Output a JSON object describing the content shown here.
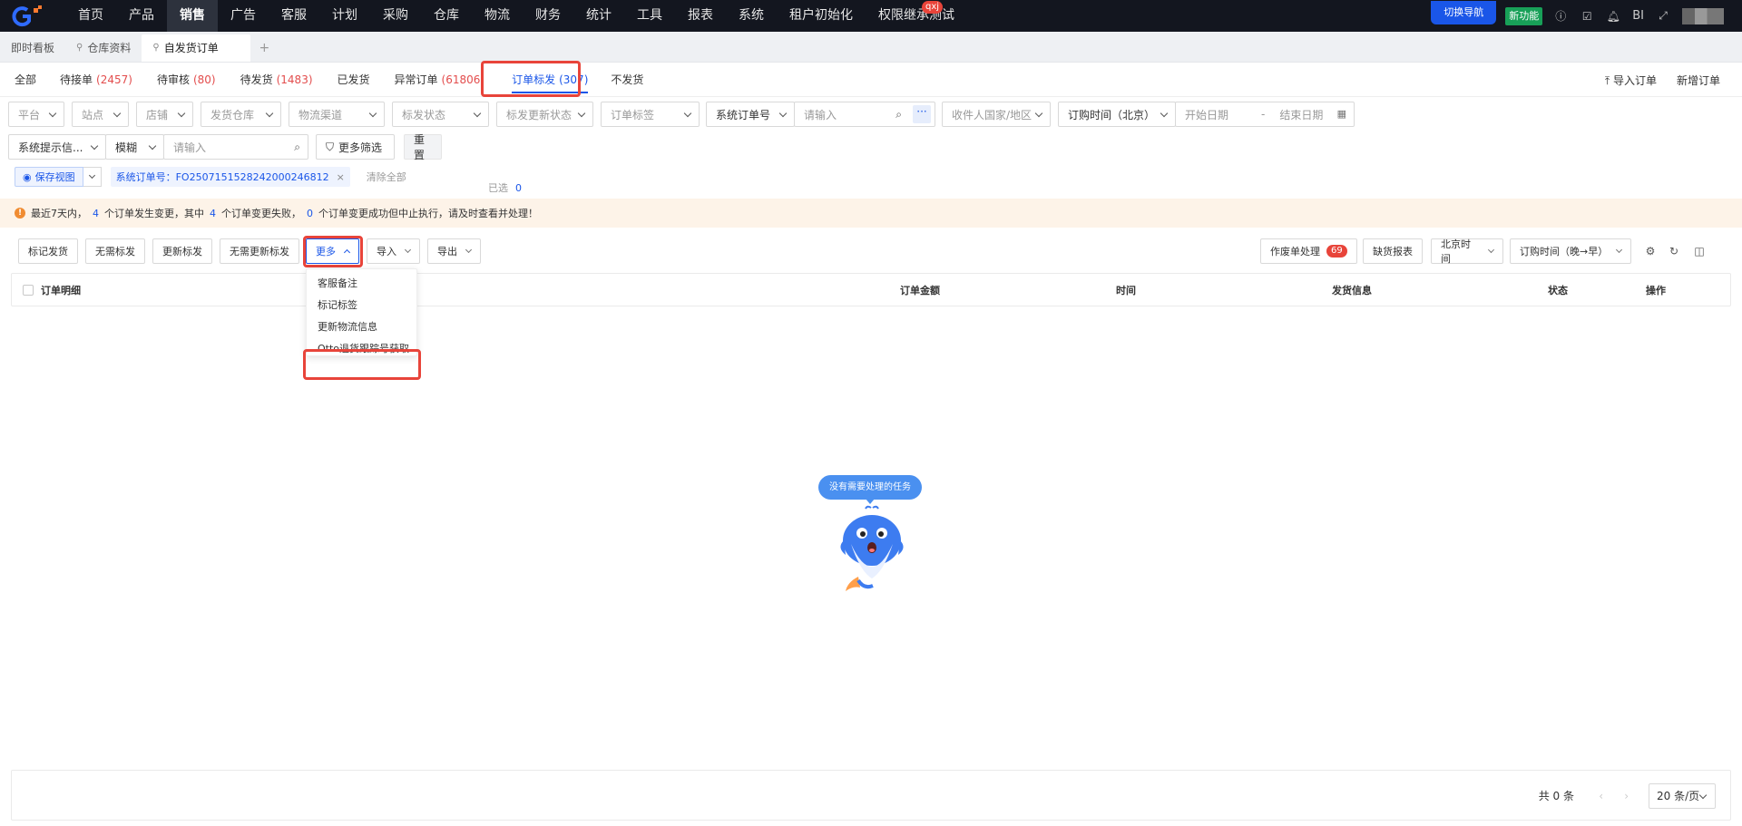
{
  "topnav": {
    "logo": "G+",
    "items": [
      "首页",
      "产品",
      "销售",
      "广告",
      "客服",
      "计划",
      "采购",
      "仓库",
      "物流",
      "财务",
      "统计",
      "工具",
      "报表",
      "系统",
      "租户初始化",
      "权限继承测试"
    ],
    "active_index": 2,
    "user_badge": "qxj",
    "switch_nav": "切换导航",
    "new_feature": "新功能",
    "bi": "BI"
  },
  "page_tabs": [
    {
      "label": "即时看板"
    },
    {
      "label": "仓库资料"
    },
    {
      "label": "自发货订单"
    }
  ],
  "status_tabs": [
    {
      "label": "全部",
      "count": ""
    },
    {
      "label": "待接单",
      "count": "(2457)"
    },
    {
      "label": "待审核",
      "count": "(80)"
    },
    {
      "label": "待发货",
      "count": "(1483)"
    },
    {
      "label": "已发货",
      "count": ""
    },
    {
      "label": "异常订单",
      "count": "(61806)"
    },
    {
      "label": "订单标发",
      "count": "(307)"
    },
    {
      "label": "不发货",
      "count": ""
    }
  ],
  "header_actions": {
    "import": "导入订单",
    "create": "新增订单"
  },
  "filters": {
    "platform": "平台",
    "site": "站点",
    "store": "店铺",
    "warehouse": "发货仓库",
    "channel": "物流渠道",
    "mark_status": "标发状态",
    "mark_update_status": "标发更新状态",
    "order_tag": "订单标签",
    "order_no_type": "系统订单号",
    "input_placeholder": "请输入",
    "country": "收件人国家/地区",
    "order_time": "订购时间（北京）",
    "start_date": "开始日期",
    "date_sep": "-",
    "end_date": "结束日期",
    "system_tip": "系统提示信...",
    "fuzzy": "模糊",
    "input2_placeholder": "请输入",
    "more_filter": "更多筛选",
    "reset": "重置"
  },
  "view": {
    "save": "保存视图",
    "chip": "系统订单号：FO250715152824200024681​2",
    "clear": "清除全部"
  },
  "notice": {
    "p1": "最近7天内，",
    "n1": "4",
    "p2": "个订单发生变更，其中",
    "n2": "4",
    "p3": "个订单变更失败，",
    "n3": "0",
    "p4": "个订单变更成功但中止执行，请及时查看并处理！"
  },
  "actions": {
    "mark": "标记发货",
    "no_mark": "无需标发",
    "update_mark": "更新标发",
    "no_update_mark": "无需更新标发",
    "more": "更多",
    "import": "导入",
    "export": "导出",
    "selected": "已选",
    "selected_count": "0",
    "void": "作废单处理",
    "void_count": "69",
    "shortage": "缺货报表",
    "timezone": "北京时间",
    "sort": "订购时间（晚→早）"
  },
  "table_headers": {
    "detail": "订单明细",
    "amount": "订单金额",
    "time": "时间",
    "shipping": "发货信息",
    "status": "状态",
    "ops": "操作"
  },
  "more_menu": [
    "客服备注",
    "标记标签",
    "更新物流信息",
    "Otto退货跟踪号获取"
  ],
  "empty_text": "没有需要处理的任务",
  "pagination": {
    "total": "共 0 条",
    "page_size": "20 条/页"
  },
  "colors": {
    "primary": "#1a56e8",
    "danger": "#e8443a",
    "nav_bg": "#13161f",
    "warn": "#f08c32"
  }
}
